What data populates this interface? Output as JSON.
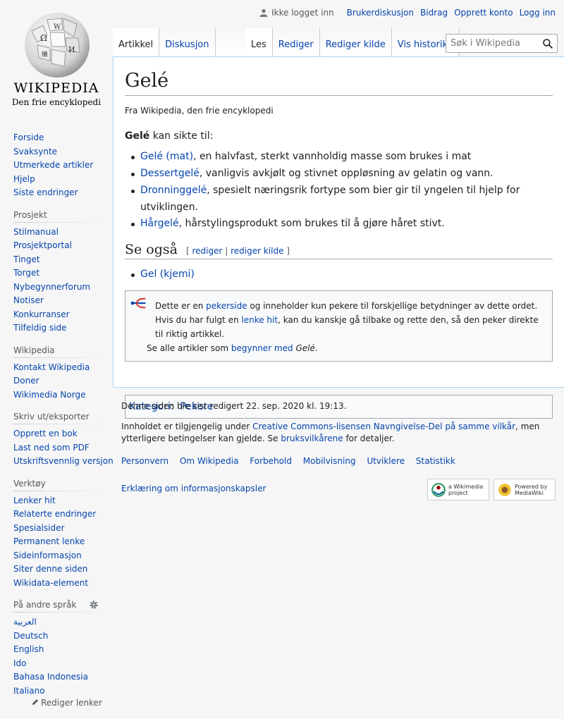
{
  "logo": {
    "wordmark": "Wikipedia",
    "tagline": "Den frie encyklopedi"
  },
  "personal": {
    "not_logged_in": "Ikke logget inn",
    "talk": "Brukerdiskusjon",
    "contributions": "Bidrag",
    "create_account": "Opprett konto",
    "login": "Logg inn"
  },
  "tabs": {
    "article": "Artikkel",
    "discussion": "Diskusjon",
    "read": "Les",
    "edit": "Rediger",
    "edit_source": "Rediger kilde",
    "history": "Vis historikk"
  },
  "search": {
    "placeholder": "Søk i Wikipedia"
  },
  "sidebar": {
    "main": [
      "Forside",
      "Svaksynte",
      "Utmerkede artikler",
      "Hjelp",
      "Siste endringer"
    ],
    "project": {
      "heading": "Prosjekt",
      "items": [
        "Stilmanual",
        "Prosjektportal",
        "Tinget",
        "Torget",
        "Nybegynnerforum",
        "Notiser",
        "Konkurranser",
        "Tilfeldig side"
      ]
    },
    "wikipedia": {
      "heading": "Wikipedia",
      "items": [
        "Kontakt Wikipedia",
        "Doner",
        "Wikimedia Norge"
      ]
    },
    "print": {
      "heading": "Skriv ut/eksporter",
      "items": [
        "Opprett en bok",
        "Last ned som PDF",
        "Utskriftsvennlig versjon"
      ]
    },
    "tools": {
      "heading": "Verktøy",
      "items": [
        "Lenker hit",
        "Relaterte endringer",
        "Spesialsider",
        "Permanent lenke",
        "Sideinformasjon",
        "Siter denne siden",
        "Wikidata-element"
      ]
    },
    "languages": {
      "heading": "På andre språk",
      "items": [
        "العربية",
        "Deutsch",
        "English",
        "Ido",
        "Bahasa Indonesia",
        "Italiano"
      ],
      "edit_links": "Rediger lenker"
    }
  },
  "article": {
    "title": "Gelé",
    "site_sub": "Fra Wikipedia, den frie encyklopedi",
    "intro_bold": "Gelé",
    "intro_rest": " kan sikte til:",
    "items": [
      {
        "link": "Gelé (mat)",
        "text": ", en halvfast, sterkt vannholdig masse som brukes i mat"
      },
      {
        "link": "Dessertgelé",
        "text": ", vanligvis avkjølt og stivnet oppløsning av gelatin og vann."
      },
      {
        "link": "Dronninggelé",
        "text": ", spesielt næringsrik fortype som bier gir til yngelen til hjelp for utviklingen."
      },
      {
        "link": "Hårgelé",
        "text": ", hårstylingsprodukt som brukes til å gjøre håret stivt."
      }
    ],
    "see_also": {
      "heading": "Se også",
      "bracket_open": "[ ",
      "edit": "rediger",
      "separator": " | ",
      "edit_source": "rediger kilde",
      "bracket_close": " ]",
      "items": [
        "Gel (kjemi)"
      ]
    },
    "dab": {
      "t1": "Dette er en ",
      "l1": "pekerside",
      "t2": " og inneholder kun pekere til forskjellige betydninger av dette ordet. Hvis du har fulgt en ",
      "l2": "lenke hit",
      "t3": ", kan du kanskje gå tilbake og rette den, så den peker direkte til riktig artikkel.",
      "t4": "Se alle artikler som ",
      "l3": "begynner med",
      "t5": " ",
      "em": "Gelé",
      "t6": "."
    },
    "category": {
      "label": "Kategori",
      "colon": ":",
      "item": "Pekere"
    }
  },
  "footer": {
    "modified": "Denne siden ble sist redigert 22. sep. 2020 kl. 19:13.",
    "license_t1": "Innholdet er tilgjengelig under ",
    "license_link": "Creative Commons-lisensen Navngivelse-Del på samme vilkår",
    "license_t2": ", men ytterligere betingelser kan gjelde. Se ",
    "terms_link": "bruksvilkårene",
    "license_t3": " for detaljer.",
    "places": [
      "Personvern",
      "Om Wikipedia",
      "Forbehold",
      "Mobilvisning",
      "Utviklere",
      "Statistikk"
    ],
    "cookie": "Erklæring om informasjonskapsler",
    "badge_wikimedia": "a Wikimedia project",
    "badge_mediawiki": "Powered by MediaWiki"
  }
}
